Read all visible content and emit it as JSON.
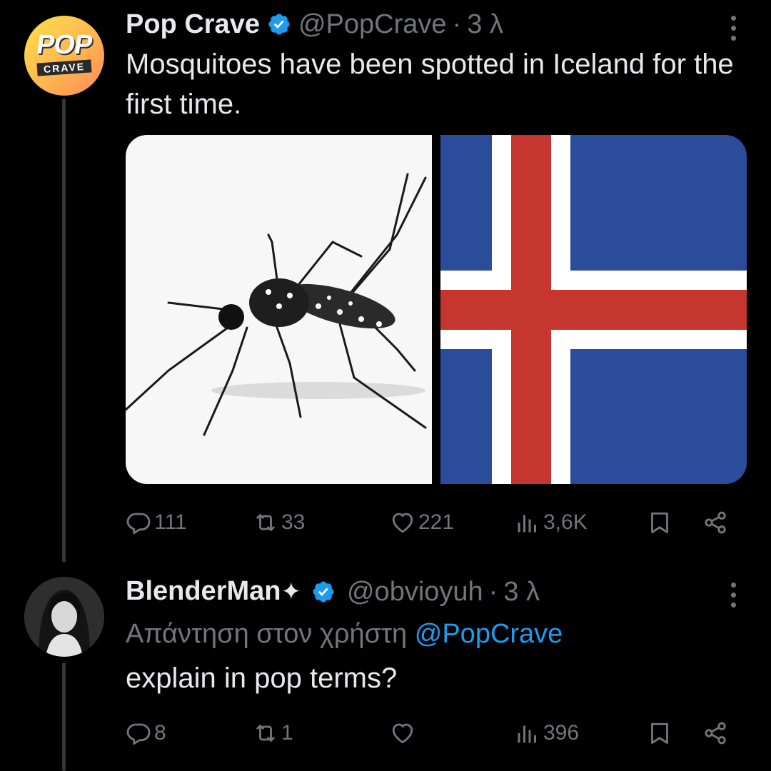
{
  "tweets": [
    {
      "name": "Pop Crave",
      "handle": "@PopCrave",
      "dot": "·",
      "time": "3 λ",
      "avatar": {
        "line1": "POP",
        "line2": "CRAVE"
      },
      "text": "Mosquitoes have been spotted in Iceland for the first time.",
      "media": [
        {
          "description": "mosquito-photo"
        },
        {
          "description": "iceland-flag",
          "colors": {
            "blue": "#2b4c9a",
            "white": "#ffffff",
            "red": "#c5372e"
          }
        }
      ],
      "actions": {
        "replies": "111",
        "reposts": "33",
        "likes": "221",
        "views": "3,6K"
      }
    },
    {
      "name": "BlenderMan",
      "name_suffix": "✦",
      "handle": "@obvioyuh",
      "dot": "·",
      "time": "3 λ",
      "reply_prefix": "Απάντηση στον χρήστη",
      "reply_mention": "@PopCrave",
      "text": "explain in pop terms?",
      "actions": {
        "replies": "8",
        "reposts": "1",
        "likes": "",
        "views": "396"
      }
    }
  ],
  "icons": [
    "verified-badge-icon",
    "more-icon",
    "reply-icon",
    "repost-icon",
    "like-icon",
    "views-icon",
    "bookmark-icon",
    "share-icon"
  ],
  "colors": {
    "background": "#000000",
    "text": "#e7e9ea",
    "muted": "#71767b",
    "accent": "#1d9bf0"
  }
}
